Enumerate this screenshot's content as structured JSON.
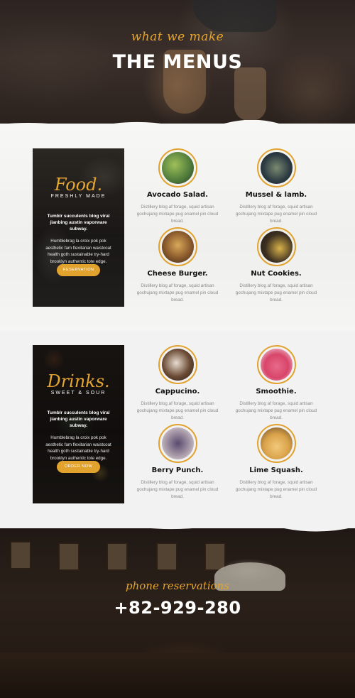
{
  "hero": {
    "subtitle": "what we make",
    "title": "THE MENUS"
  },
  "food_section": {
    "promo": {
      "title": "Food.",
      "subtitle": "FRESHLY MADE",
      "bold_text": "Tumblr succulents blog viral jianbing austin vaporware subway.",
      "text": "Humblebrag la croix pok pok aesthetic fam flexitarian waistcoat health goth sustainable try-hard brooklyn authentic tote edge.",
      "button": "RESERVATION"
    },
    "items": [
      {
        "name": "Avocado Salad.",
        "description": "Distillery blog af forage, squid artisan gochujang mixtape pug enamel pin cloud bread.",
        "icon": "salad-photo",
        "color": "#4d7a3a"
      },
      {
        "name": "Mussel & lamb.",
        "description": "Distillery blog af forage, squid artisan gochujang mixtape pug enamel pin cloud bread.",
        "icon": "mussel-photo",
        "color": "#2c3a42"
      },
      {
        "name": "Cheese Burger.",
        "description": "Distillery blog af forage, squid artisan gochujang mixtape pug enamel pin cloud bread.",
        "icon": "burger-photo",
        "color": "#8a5a2c"
      },
      {
        "name": "Nut Cookies.",
        "description": "Distillery blog af forage, squid artisan gochujang mixtape pug enamel pin cloud bread.",
        "icon": "cookies-photo",
        "color": "#3d3020"
      }
    ]
  },
  "drinks_section": {
    "promo": {
      "title": "Drinks.",
      "subtitle": "SWEET & SOUR",
      "bold_text": "Tumblr succulents blog viral jianbing austin vaporware subway.",
      "text": "Humblebrag la croix pok pok aesthetic fam flexitarian waistcoat health goth sustainable try-hard brooklyn authentic tote edge.",
      "button": "ORDER NOW"
    },
    "items": [
      {
        "name": "Cappucino.",
        "description": "Distillery blog af forage, squid artisan gochujang mixtape pug enamel pin cloud bread.",
        "icon": "cappucino-photo",
        "color": "#6a4a34"
      },
      {
        "name": "Smoothie.",
        "description": "Distillery blog af forage, squid artisan gochujang mixtape pug enamel pin cloud bread.",
        "icon": "smoothie-photo",
        "color": "#d8456a"
      },
      {
        "name": "Berry Punch.",
        "description": "Distillery blog af forage, squid artisan gochujang mixtape pug enamel pin cloud bread.",
        "icon": "berry-punch-photo",
        "color": "#a89aa8"
      },
      {
        "name": "Lime Squash.",
        "description": "Distillery blog af forage, squid artisan gochujang mixtape pug enamel pin cloud bread.",
        "icon": "lime-squash-photo",
        "color": "#d9a24a"
      }
    ]
  },
  "footer": {
    "subtitle": "phone reservations",
    "phone": "+82-929-280"
  },
  "colors": {
    "accent": "#e2a22e",
    "heading": "#111111",
    "muted": "#8a8a8a"
  }
}
